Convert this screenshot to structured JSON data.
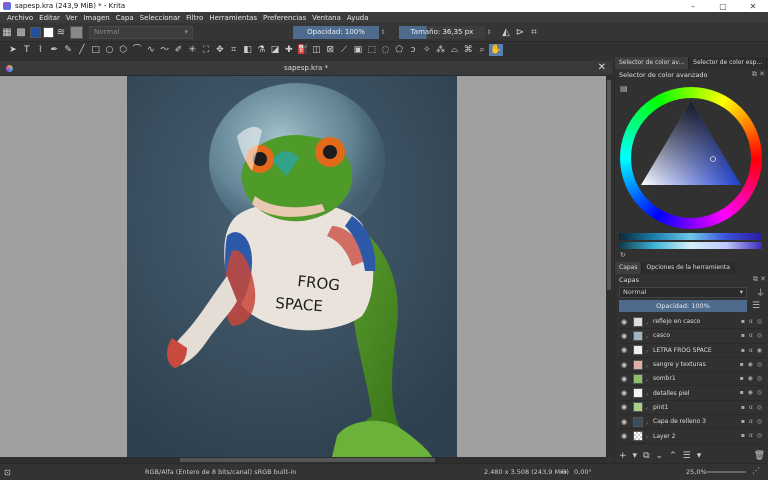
{
  "window": {
    "title": "sapesp.kra (243,9 MiB)  * - Krita",
    "minimize": "–",
    "maximize": "▢",
    "close": "✕"
  },
  "menu": [
    "Archivo",
    "Editar",
    "Ver",
    "Imagen",
    "Capa",
    "Seleccionar",
    "Filtro",
    "Herramientas",
    "Preferencias",
    "Ventana",
    "Ayuda"
  ],
  "options_bar": {
    "blend_mode": "Normal",
    "opacity": "Opacidad: 100%",
    "size": "Tamaño: 36,35 px",
    "fg_color": "#1f4f9e",
    "bg_color": "#ffffff"
  },
  "document": {
    "tab_title": "sapesp.kra *",
    "close": "✕"
  },
  "dock": {
    "tabs": [
      "Selector de color av...",
      "Selector de color esp..."
    ],
    "color_docker_title": "Selector de color avanzado",
    "layers_tabs": [
      "Capas",
      "Opciones de la herramienta"
    ],
    "layers_title": "Capas",
    "layer_blend_mode": "Normal",
    "layer_opacity": "Opacidad:  100%",
    "layers": [
      {
        "name": "reflejo en casco"
      },
      {
        "name": "casco"
      },
      {
        "name": "LETRA FROG SPACE"
      },
      {
        "name": "sangre y texturas"
      },
      {
        "name": "sombr1"
      },
      {
        "name": "detalles piel"
      },
      {
        "name": "pint1"
      },
      {
        "name": "Capa de relleno 3"
      },
      {
        "name": "Layer 2"
      }
    ]
  },
  "artwork": {
    "text_line1": "FROG",
    "text_line2": "SPACE"
  },
  "status": {
    "color_space": "RGB/Alfa (Entero de 8 bits/canal)  sRGB built-in",
    "dimensions": "2.480 x 3.508 (243,9 MiB)",
    "rotation": "0,00°",
    "zoom": "25,0%"
  }
}
